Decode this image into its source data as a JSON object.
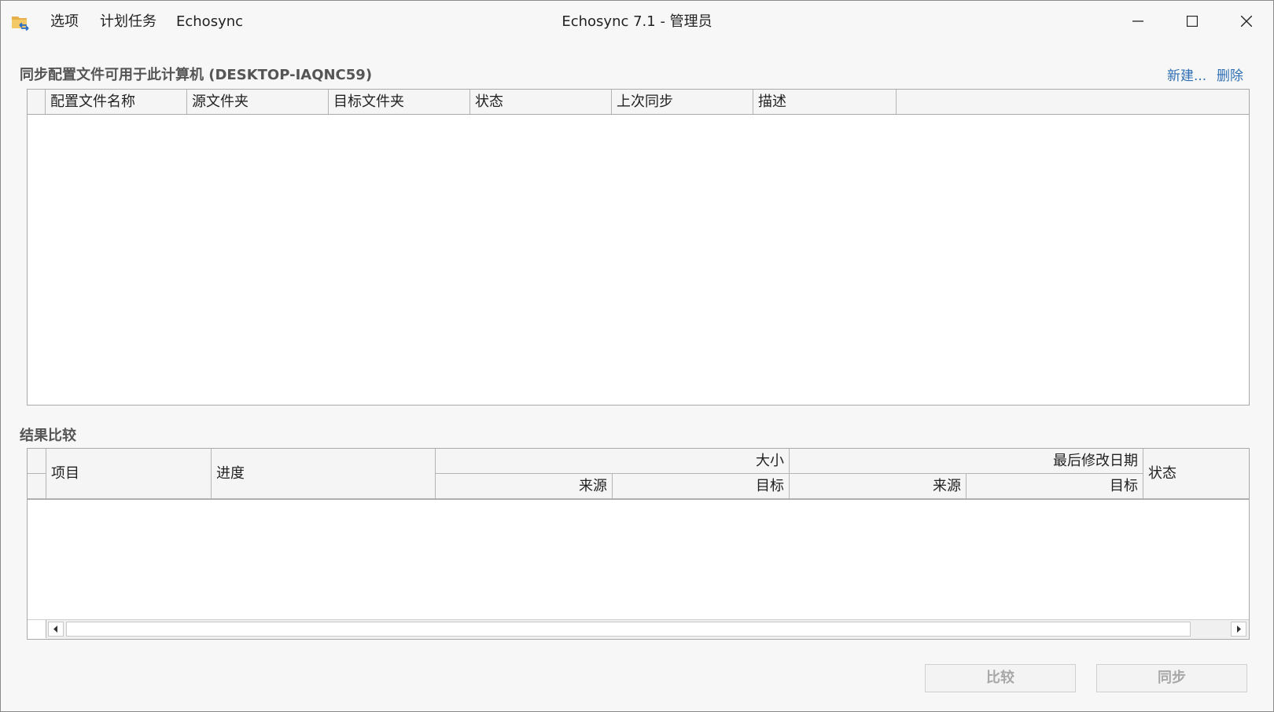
{
  "window": {
    "title": "Echosync 7.1 - 管理员",
    "app_icon": "folder-sync-icon",
    "controls": [
      "minimize-icon",
      "maximize-icon",
      "close-icon"
    ]
  },
  "menu": {
    "options": "选项",
    "scheduled_tasks": "计划任务",
    "echosync": "Echosync"
  },
  "profiles": {
    "heading": "同步配置文件可用于此计算机 (DESKTOP-IAQNC59)",
    "new_link": "新建...",
    "delete_link": "删除",
    "columns": [
      "配置文件名称",
      "源文件夹",
      "目标文件夹",
      "状态",
      "上次同步",
      "描述"
    ]
  },
  "results": {
    "heading": "结果比较",
    "col_item": "项目",
    "col_progress": "进度",
    "col_size": "大小",
    "col_size_source": "来源",
    "col_size_target": "目标",
    "col_modified": "最后修改日期",
    "col_modified_source": "来源",
    "col_modified_target": "目标",
    "col_status": "状态"
  },
  "buttons": {
    "compare": "比较",
    "sync": "同步"
  },
  "colors": {
    "link": "#2f6fb5",
    "disabled_text": "#a8a8a8",
    "border": "#a9a9a9"
  }
}
